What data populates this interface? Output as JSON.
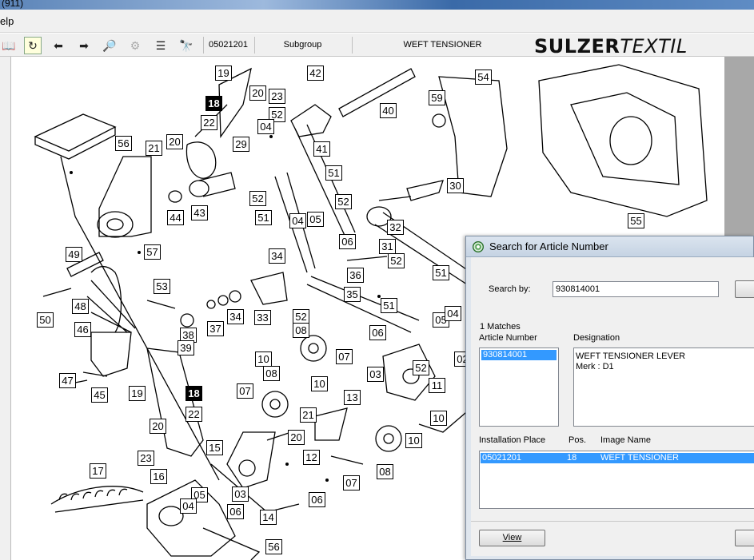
{
  "window": {
    "title_fragment": "(911)"
  },
  "menu": {
    "help_fragment": "elp"
  },
  "toolbar": {
    "code": "05021201",
    "subgroup_label": "Subgroup",
    "group_name": "WEFT TENSIONER",
    "logo_bold": "SULZER",
    "logo_italic": "TEXTIL"
  },
  "drawing": {
    "callouts": [
      {
        "t": "19"
      },
      {
        "t": "18",
        "inv": true
      },
      {
        "t": "20"
      },
      {
        "t": "22"
      },
      {
        "t": "23"
      },
      {
        "t": "52"
      },
      {
        "t": "42"
      },
      {
        "t": "40"
      },
      {
        "t": "54"
      },
      {
        "t": "59"
      },
      {
        "t": "41"
      },
      {
        "t": "56"
      },
      {
        "t": "21"
      },
      {
        "t": "20"
      },
      {
        "t": "29"
      },
      {
        "t": "51"
      },
      {
        "t": "44"
      },
      {
        "t": "43"
      },
      {
        "t": "52"
      },
      {
        "t": "30"
      },
      {
        "t": "51"
      },
      {
        "t": "52"
      },
      {
        "t": "04"
      },
      {
        "t": "05"
      },
      {
        "t": "32"
      },
      {
        "t": "55"
      },
      {
        "t": "06"
      },
      {
        "t": "31"
      },
      {
        "t": "57"
      },
      {
        "t": "49"
      },
      {
        "t": "34"
      },
      {
        "t": "52"
      },
      {
        "t": "51"
      },
      {
        "t": "36"
      },
      {
        "t": "53"
      },
      {
        "t": "35"
      },
      {
        "t": "48"
      },
      {
        "t": "33"
      },
      {
        "t": "34"
      },
      {
        "t": "37"
      },
      {
        "t": "38"
      },
      {
        "t": "52"
      },
      {
        "t": "08"
      },
      {
        "t": "51"
      },
      {
        "t": "50"
      },
      {
        "t": "46"
      },
      {
        "t": "39"
      },
      {
        "t": "06"
      },
      {
        "t": "05"
      },
      {
        "t": "04"
      },
      {
        "t": "07"
      },
      {
        "t": "10"
      },
      {
        "t": "08"
      },
      {
        "t": "47"
      },
      {
        "t": "45"
      },
      {
        "t": "19"
      },
      {
        "t": "18",
        "inv": true
      },
      {
        "t": "03"
      },
      {
        "t": "52"
      },
      {
        "t": "02"
      },
      {
        "t": "10"
      },
      {
        "t": "07"
      },
      {
        "t": "11"
      },
      {
        "t": "13"
      },
      {
        "t": "22"
      },
      {
        "t": "21"
      },
      {
        "t": "20"
      },
      {
        "t": "20"
      },
      {
        "t": "15"
      },
      {
        "t": "10"
      },
      {
        "t": "10"
      },
      {
        "t": "23"
      },
      {
        "t": "12"
      },
      {
        "t": "16"
      },
      {
        "t": "17"
      },
      {
        "t": "05"
      },
      {
        "t": "03"
      },
      {
        "t": "07"
      },
      {
        "t": "08"
      },
      {
        "t": "04"
      },
      {
        "t": "06"
      },
      {
        "t": "06"
      },
      {
        "t": "14"
      },
      {
        "t": "56"
      },
      {
        "t": "04"
      }
    ]
  },
  "dialog": {
    "title": "Search for Article Number",
    "search_by_label": "Search by:",
    "search_value": "930814001",
    "matches_label": "1 Matches",
    "col_article": "Article Number",
    "col_designation": "Designation",
    "article_value": "930814001",
    "designation_line1": "WEFT TENSIONER LEVER",
    "designation_line2": "Merk : D1",
    "col_install": "Installation Place",
    "col_pos": "Pos.",
    "col_image": "Image Name",
    "row_install": "05021201",
    "row_pos": "18",
    "row_image": "WEFT TENSIONER",
    "view_button": "View"
  },
  "colors": {
    "selection": "#3399ff",
    "dialog_bg": "#f0f0f0",
    "titlebar": "#c5d3e3"
  }
}
